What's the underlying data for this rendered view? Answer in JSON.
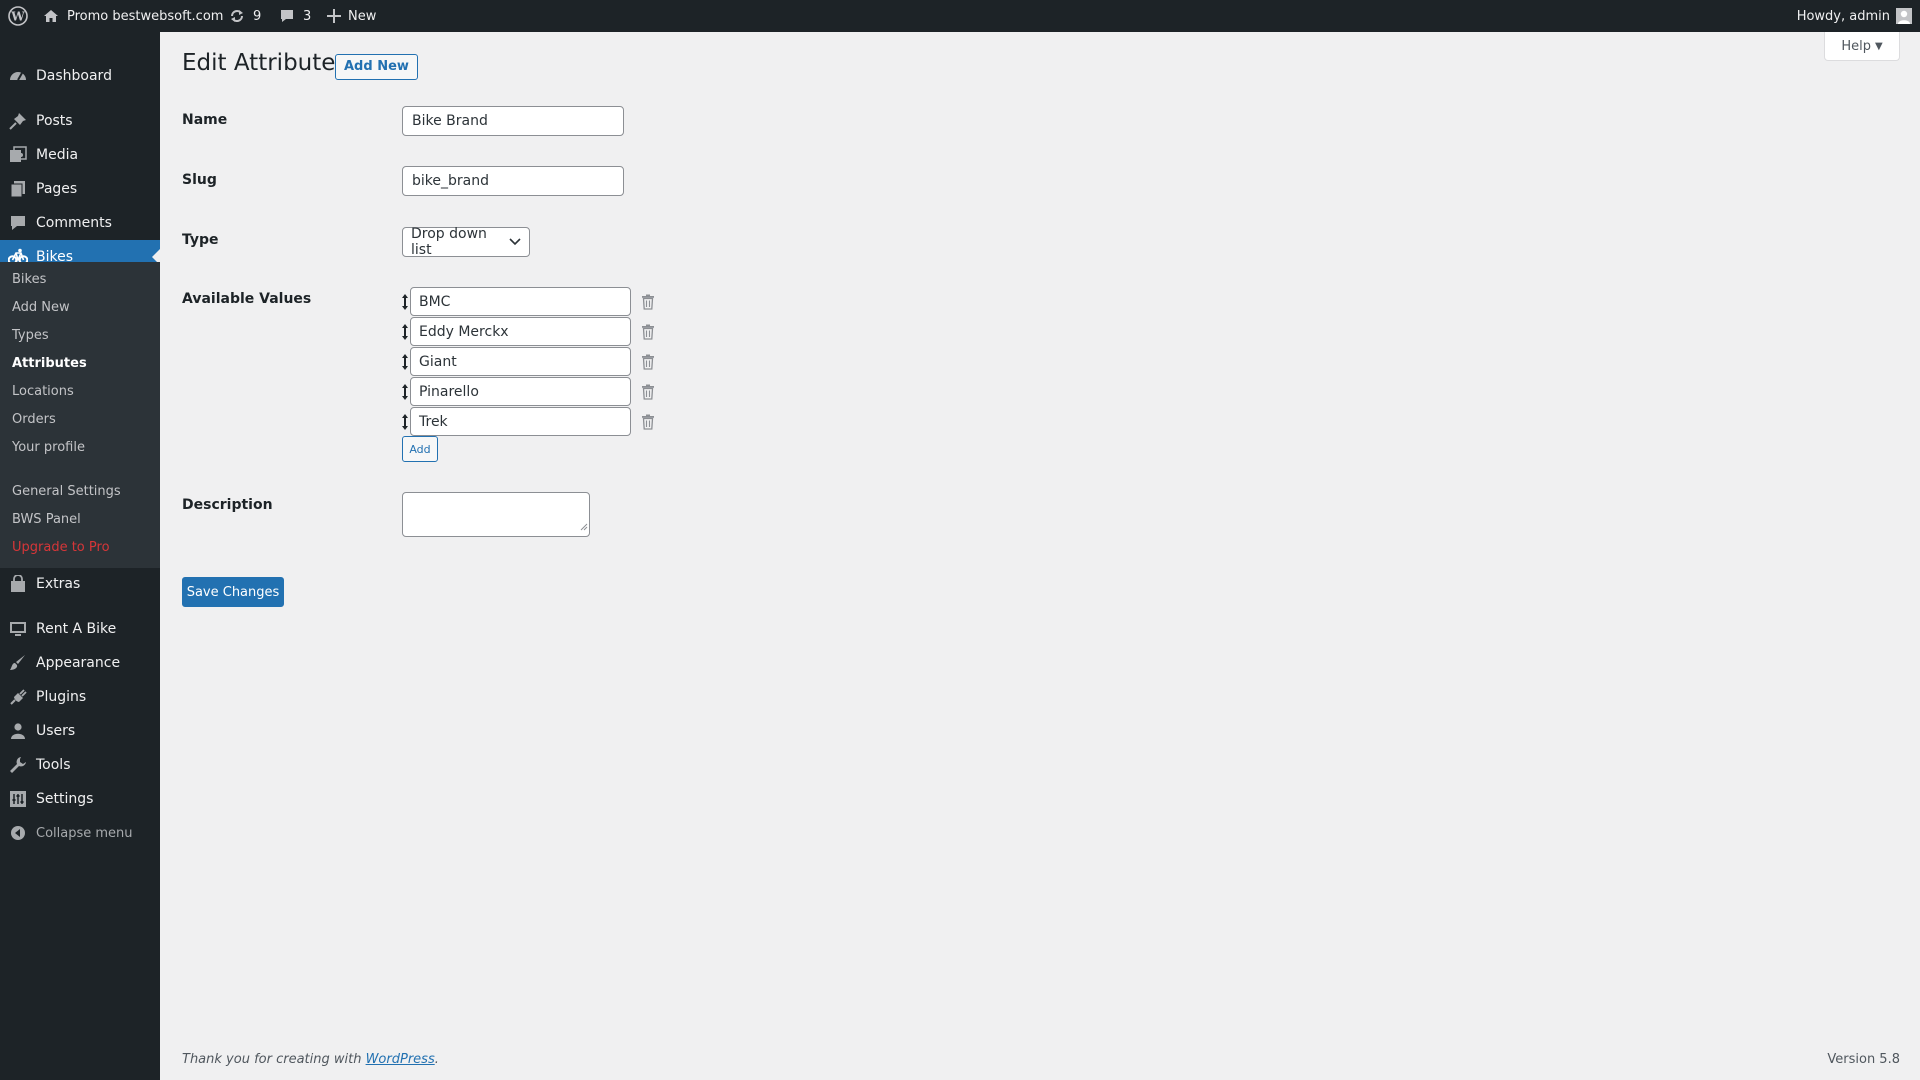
{
  "admin_bar": {
    "site_name": "Promo bestwebsoft.com",
    "updates_count": "9",
    "comments_count": "3",
    "new_label": "New",
    "howdy": "Howdy, admin"
  },
  "sidebar": {
    "top_items": [
      {
        "label": "Dashboard",
        "icon": "dashboard-icon"
      },
      {
        "label": "Posts",
        "icon": "pin-icon"
      },
      {
        "label": "Media",
        "icon": "media-icon"
      },
      {
        "label": "Pages",
        "icon": "pages-icon"
      },
      {
        "label": "Comments",
        "icon": "comment-icon"
      },
      {
        "label": "Bikes",
        "icon": "bike-icon"
      }
    ],
    "submenu": [
      {
        "label": "Bikes"
      },
      {
        "label": "Add New"
      },
      {
        "label": "Types"
      },
      {
        "label": "Attributes"
      },
      {
        "label": "Locations"
      },
      {
        "label": "Orders"
      },
      {
        "label": "Your profile"
      },
      {
        "label": "General Settings"
      },
      {
        "label": "BWS Panel"
      },
      {
        "label": "Upgrade to Pro"
      }
    ],
    "bottom_items": [
      {
        "label": "Extras",
        "icon": "bag-icon"
      },
      {
        "label": "Rent A Bike",
        "icon": "monitor-icon"
      },
      {
        "label": "Appearance",
        "icon": "brush-icon"
      },
      {
        "label": "Plugins",
        "icon": "plug-icon"
      },
      {
        "label": "Users",
        "icon": "user-icon"
      },
      {
        "label": "Tools",
        "icon": "wrench-icon"
      },
      {
        "label": "Settings",
        "icon": "settings-icon"
      },
      {
        "label": "Collapse menu",
        "icon": "collapse-icon"
      }
    ]
  },
  "page": {
    "title": "Edit Attribute",
    "add_new": "Add New",
    "help": "Help"
  },
  "form": {
    "name_label": "Name",
    "name_value": "Bike Brand",
    "slug_label": "Slug",
    "slug_value": "bike_brand",
    "type_label": "Type",
    "type_value": "Drop down list",
    "values_label": "Available Values",
    "values": [
      "BMC",
      "Eddy Merckx",
      "Giant",
      "Pinarello",
      "Trek"
    ],
    "add_label": "Add",
    "description_label": "Description",
    "description_value": "",
    "save_label": "Save Changes"
  },
  "footer": {
    "thanks_prefix": "Thank you for creating with ",
    "wordpress_link": "WordPress",
    "thanks_suffix": ".",
    "version": "Version 5.8"
  },
  "colors": {
    "admin_bar": "#1d2327",
    "accent": "#2271b1",
    "background": "#f0f0f1",
    "upgrade": "#d63638"
  }
}
